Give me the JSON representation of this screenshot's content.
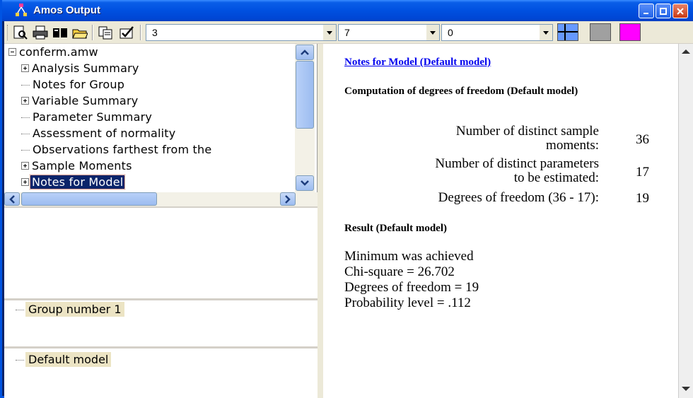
{
  "window": {
    "title": "Amos Output"
  },
  "toolbar": {
    "icons": [
      "print-preview-icon",
      "print-icon",
      "open-book-icon",
      "open-folder-icon",
      "copy-icon",
      "options-icon"
    ],
    "decimals_combo": "3",
    "table_combo": "7",
    "col_combo": "0",
    "colors": {
      "swatch_grid": "#6699ff",
      "swatch_gray": "#a0a0a0",
      "swatch_magenta": "#ff00ff",
      "selection": "#0a246a"
    }
  },
  "tree": {
    "root": "conferm.amw",
    "items": [
      {
        "label": "Analysis Summary",
        "expander": "plus"
      },
      {
        "label": "Notes for Group",
        "expander": "none"
      },
      {
        "label": "Variable Summary",
        "expander": "plus"
      },
      {
        "label": "Parameter Summary",
        "expander": "none"
      },
      {
        "label": "Assessment of normality",
        "expander": "none"
      },
      {
        "label": "Observations farthest from the",
        "expander": "none"
      },
      {
        "label": "Sample Moments",
        "expander": "plus"
      },
      {
        "label": "Notes for Model",
        "expander": "plus",
        "selected": true
      }
    ]
  },
  "groups": {
    "group_label": "Group number 1"
  },
  "models": {
    "model_label": "Default model"
  },
  "content": {
    "link": "Notes for Model (Default model)",
    "computation_heading": "Computation of degrees of freedom (Default model)",
    "rows": [
      {
        "label_line1": "Number of distinct sample",
        "label_line2": "moments:",
        "value": "36"
      },
      {
        "label_line1": "Number of distinct parameters",
        "label_line2": "to be estimated:",
        "value": "17"
      },
      {
        "label_line1": "Degrees of freedom (36 - 17):",
        "label_line2": "",
        "value": "19"
      }
    ],
    "result_heading": "Result (Default model)",
    "result_lines": [
      "Minimum was achieved",
      "Chi-square = 26.702",
      "Degrees of freedom = 19",
      "Probability level = .112"
    ]
  }
}
